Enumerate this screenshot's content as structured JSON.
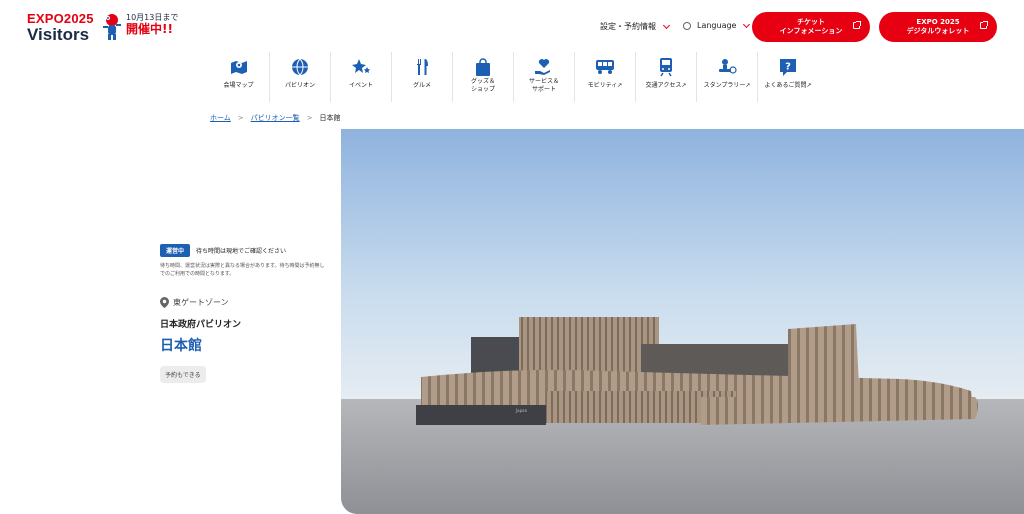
{
  "header": {
    "logo_line1": "EXPO2025",
    "logo_line2": "Visitors",
    "promo_date": "10月13日まで",
    "promo_main": "開催中!!",
    "settings_label": "設定・予約情報",
    "language_label": "Language",
    "ticket_button": {
      "line1": "チケット",
      "line2": "インフォメーション"
    },
    "wallet_button": {
      "line1": "EXPO 2025",
      "line2": "デジタルウォレット"
    }
  },
  "nav": {
    "items": [
      {
        "icon": "map-icon",
        "label": "会場マップ"
      },
      {
        "icon": "globe-icon",
        "label": "パビリオン"
      },
      {
        "icon": "stars-icon",
        "label": "イベント"
      },
      {
        "icon": "cutlery-icon",
        "label": "グルメ"
      },
      {
        "icon": "shopping-bag-icon",
        "label": "グッズ＆\nショップ"
      },
      {
        "icon": "heart-hand-icon",
        "label": "サービス＆\nサポート"
      },
      {
        "icon": "mobility-icon",
        "label": "モビリティ↗"
      },
      {
        "icon": "train-icon",
        "label": "交通アクセス↗"
      },
      {
        "icon": "stamp-icon",
        "label": "スタンプラリー↗"
      },
      {
        "icon": "question-icon",
        "label": "よくあるご質問↗"
      }
    ]
  },
  "breadcrumb": {
    "home": "ホーム",
    "list": "パビリオン一覧",
    "current": "日本館"
  },
  "pavilion": {
    "status_badge": "運営中",
    "status_text": "待ち時間は現地でご確認ください",
    "note": "待ち時間、運営状況は実際と異なる場合があります。待ち時間は予約無しでのご利用での時間となります。",
    "zone": "東ゲートゾーン",
    "subtitle": "日本政府パビリオン",
    "title": "日本館",
    "tag": "予約もできる"
  },
  "colors": {
    "accent_red": "#e60012",
    "accent_blue": "#1d5fb3",
    "navy": "#1d2a44"
  }
}
